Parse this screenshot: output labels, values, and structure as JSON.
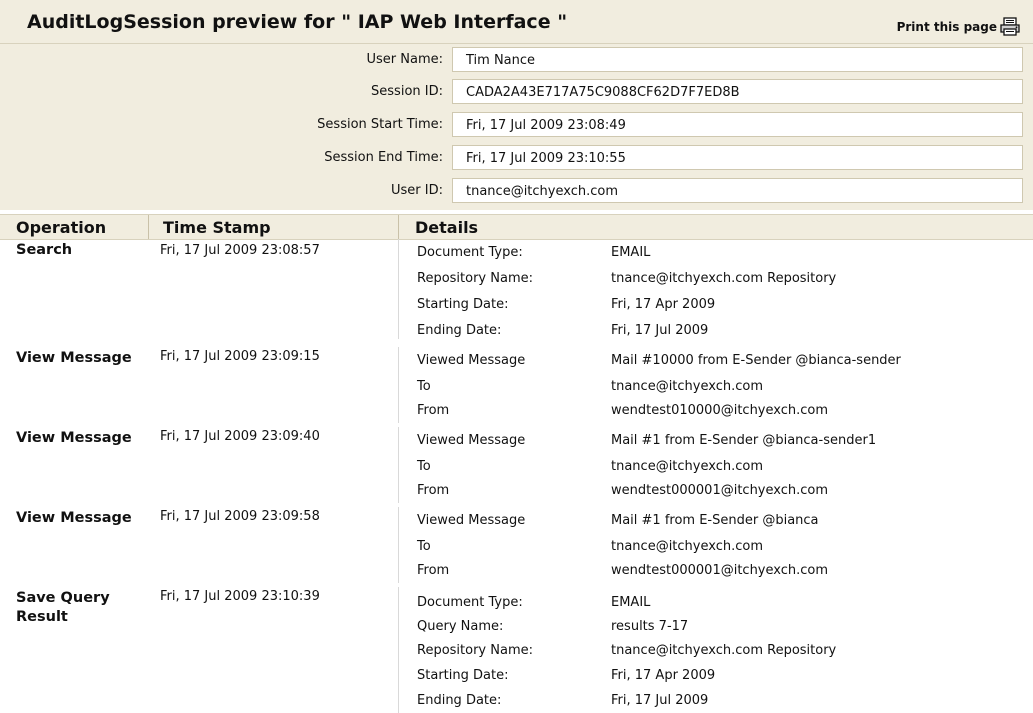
{
  "header": {
    "title": "AuditLogSession preview for \" IAP Web Interface \"",
    "print_label": "Print this page"
  },
  "session": {
    "fields": [
      {
        "label": "User Name:",
        "value": "Tim Nance"
      },
      {
        "label": "Session ID:",
        "value": "CADA2A43E717A75C9088CF62D7F7ED8B"
      },
      {
        "label": "Session Start Time:",
        "value": "Fri, 17 Jul 2009 23:08:49"
      },
      {
        "label": "Session End Time:",
        "value": "Fri, 17 Jul 2009 23:10:55"
      },
      {
        "label": "User ID:",
        "value": "tnance@itchyexch.com"
      }
    ]
  },
  "table": {
    "columns": [
      "Operation",
      "Time Stamp",
      "Details"
    ],
    "rows": [
      {
        "operation": "Search",
        "timestamp": "Fri, 17 Jul 2009 23:08:57",
        "details": [
          {
            "label": "Document Type:",
            "value": "EMAIL"
          },
          {
            "label": "Repository Name:",
            "value": "tnance@itchyexch.com Repository"
          },
          {
            "label": "Starting Date:",
            "value": "Fri, 17 Apr 2009"
          },
          {
            "label": "Ending Date:",
            "value": "Fri, 17 Jul 2009"
          }
        ]
      },
      {
        "operation": "View Message",
        "timestamp": "Fri, 17 Jul 2009 23:09:15",
        "details": [
          {
            "label": "Viewed Message",
            "value": "Mail #10000 from E-Sender @bianca-sender"
          },
          {
            "label": "To",
            "value": "tnance@itchyexch.com"
          },
          {
            "label": "From",
            "value": "wendtest010000@itchyexch.com"
          }
        ]
      },
      {
        "operation": "View Message",
        "timestamp": "Fri, 17 Jul 2009 23:09:40",
        "details": [
          {
            "label": "Viewed Message",
            "value": "Mail #1 from E-Sender @bianca-sender1"
          },
          {
            "label": "To",
            "value": "tnance@itchyexch.com"
          },
          {
            "label": "From",
            "value": "wendtest000001@itchyexch.com"
          }
        ]
      },
      {
        "operation": "View Message",
        "timestamp": "Fri, 17 Jul 2009 23:09:58",
        "details": [
          {
            "label": "Viewed Message",
            "value": "Mail #1 from E-Sender @bianca"
          },
          {
            "label": "To",
            "value": "tnance@itchyexch.com"
          },
          {
            "label": "From",
            "value": "wendtest000001@itchyexch.com"
          }
        ]
      },
      {
        "operation": "Save Query Result",
        "timestamp": "Fri, 17 Jul 2009 23:10:39",
        "details": [
          {
            "label": "Document Type:",
            "value": "EMAIL"
          },
          {
            "label": "Query Name:",
            "value": "results 7-17"
          },
          {
            "label": "Repository Name:",
            "value": "tnance@itchyexch.com Repository"
          },
          {
            "label": "Starting Date:",
            "value": "Fri, 17 Apr 2009"
          },
          {
            "label": "Ending Date:",
            "value": "Fri, 17 Jul 2009"
          }
        ]
      }
    ]
  },
  "icons": {
    "print": "printer-icon"
  },
  "colors": {
    "header_bg": "#f1eddf",
    "border": "#cfc8b0"
  }
}
